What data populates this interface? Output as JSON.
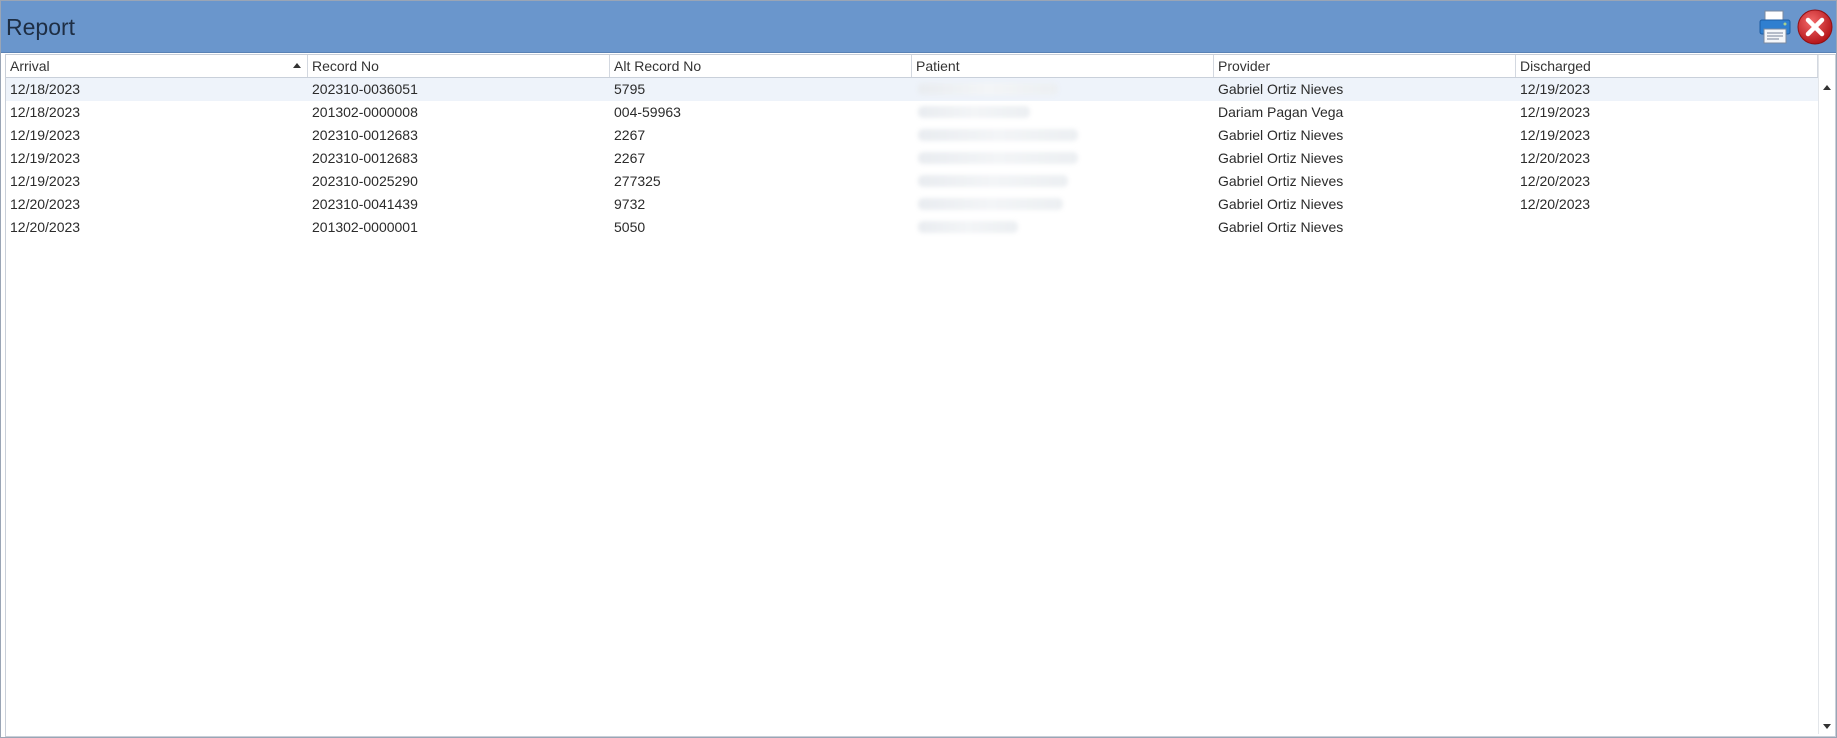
{
  "window": {
    "title": "Report"
  },
  "toolbar": {
    "print_icon": "printer-icon",
    "close_icon": "close-icon"
  },
  "colors": {
    "titlebar": "#6a96cc",
    "selected_row": "#eef3fa",
    "close_red": "#d9262b"
  },
  "columns": [
    {
      "label": "Arrival",
      "sorted": "ascending"
    },
    {
      "label": "Record No"
    },
    {
      "label": "Alt Record No"
    },
    {
      "label": "Patient"
    },
    {
      "label": "Provider"
    },
    {
      "label": "Discharged"
    }
  ],
  "rows": [
    {
      "arrival": "12/18/2023",
      "record_no": "202310-0036051",
      "alt_record_no": "5795",
      "provider": "Gabriel Ortiz Nieves",
      "discharged": "12/19/2023"
    },
    {
      "arrival": "12/18/2023",
      "record_no": "201302-0000008",
      "alt_record_no": "004-59963",
      "provider": "Dariam Pagan Vega",
      "discharged": "12/19/2023"
    },
    {
      "arrival": "12/19/2023",
      "record_no": "202310-0012683",
      "alt_record_no": "2267",
      "provider": "Gabriel Ortiz Nieves",
      "discharged": "12/19/2023"
    },
    {
      "arrival": "12/19/2023",
      "record_no": "202310-0012683",
      "alt_record_no": "2267",
      "provider": "Gabriel Ortiz Nieves",
      "discharged": "12/20/2023"
    },
    {
      "arrival": "12/19/2023",
      "record_no": "202310-0025290",
      "alt_record_no": "277325",
      "provider": "Gabriel Ortiz Nieves",
      "discharged": "12/20/2023"
    },
    {
      "arrival": "12/20/2023",
      "record_no": "202310-0041439",
      "alt_record_no": "9732",
      "provider": "Gabriel Ortiz Nieves",
      "discharged": "12/20/2023"
    },
    {
      "arrival": "12/20/2023",
      "record_no": "201302-0000001",
      "alt_record_no": "5050",
      "provider": "Gabriel Ortiz Nieves",
      "discharged": ""
    }
  ]
}
